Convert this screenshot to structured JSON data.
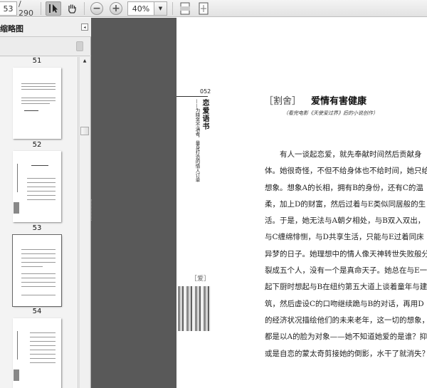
{
  "toolbar": {
    "page_current": "53",
    "page_total": "/ 290",
    "zoom": "40%",
    "zoom_out": "−",
    "zoom_in": "+",
    "dropdown": "▼"
  },
  "sidebar": {
    "title": "缩略图",
    "collapse": "◂",
    "scroll_up": "▲",
    "thumbnails": [
      {
        "label": "51"
      },
      {
        "label": "52"
      },
      {
        "label": "53"
      },
      {
        "label": "54"
      }
    ]
  },
  "page": {
    "page_number": "052",
    "book_title": "恋爱语书",
    "book_subtitle": "——为晓笑不满者，量身打造的情人订单",
    "section_tag": "［爱］",
    "heading_bracket": "［割舍］",
    "heading": "爱情有害健康",
    "subheading": "（看完电影《天使爱过界》后的小说创作）",
    "body_lines": [
      "　　有人一谈起恋爱，就先奉献时间然后贡献身",
      "体。她很奇怪，不但不给身体也不给时间，她只给",
      "想象。想象A的长相，拥有B的身份，还有C的温",
      "柔，加上D的财富，然后过着与E类似同居般的生",
      "活。于是，她无法与A朝夕相处，与B双入双出，",
      "与C缠绵悱恻，与D共享生活，只能与E过着同床",
      "异梦的日子。她理想中的情人像天神转世失败般分",
      "裂成五个人，没有一个是真命天子。她总在与E一",
      "起下厨时想起与B在纽约第五大道上谈着童年与建",
      "筑，然后虚设C的口吻继续跪与B的对话，再用D",
      "的经济状况描绘他们的未来老年，这一切的想象，",
      "都是以A的脸为对象——她不知道她爱的是谁？抑",
      "或是自恋的蒙太奇剪接她的倒影，水干了就消失？"
    ]
  }
}
